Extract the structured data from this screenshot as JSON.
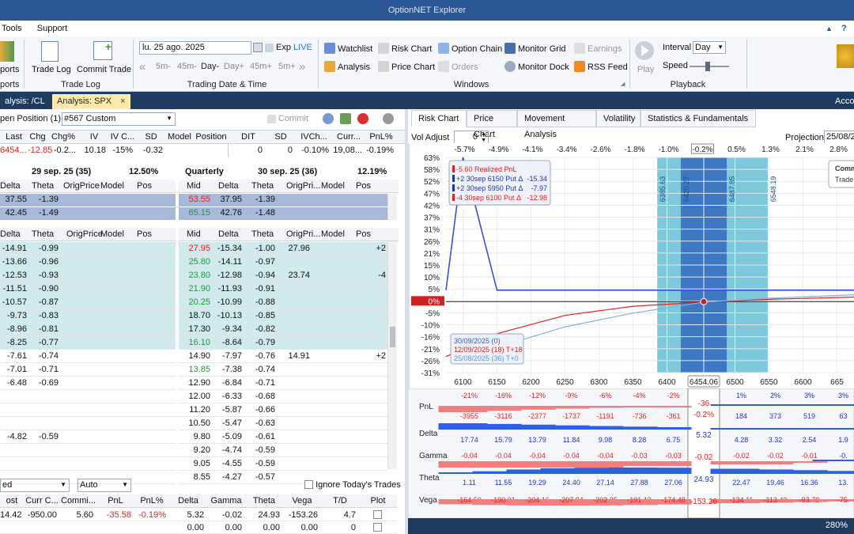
{
  "app": {
    "title": "OptionNET Explorer"
  },
  "menu": {
    "tools": "Tools",
    "support": "Support",
    "help": "?"
  },
  "ribbon": {
    "reports_btn": "ports",
    "reports_group": "ports",
    "trade_log_btn": "Trade Log",
    "commit_trade_btn": "Commit Trade",
    "trade_log_group": "Trade Log",
    "date_value": "lu. 25 ago. 2025",
    "exp_label": "Exp",
    "live_label": "LIVE",
    "step_buttons": [
      "5m-",
      "45m-",
      "Day-",
      "Day+",
      "45m+",
      "5m+"
    ],
    "date_group": "Trading Date & Time",
    "windows": [
      [
        "Watchlist",
        "Risk Chart",
        "Option Chain",
        "Monitor Grid",
        "Earnings"
      ],
      [
        "Analysis",
        "Price Chart",
        "Orders",
        "Monitor Dock",
        "RSS Feed"
      ]
    ],
    "windows_group": "Windows",
    "play_label": "Play",
    "interval_label": "Interval",
    "interval_value": "Day",
    "speed_label": "Speed",
    "playback_group": "Playback",
    "accent": "#2b5797"
  },
  "tabs": [
    {
      "label": "alysis: /CL"
    },
    {
      "label": "Analysis: SPX"
    }
  ],
  "tab_close": "×",
  "tabs_right": "Accou",
  "left": {
    "position_label": "pen Position (1)",
    "position_value": "#567 Custom",
    "commit": "Commit",
    "quote_headers": [
      "Last",
      "Chg",
      "Chg%",
      "IV",
      "IV C...",
      "SD",
      "Model",
      "Position",
      "DIT",
      "SD",
      "IVCh...",
      "Curr...",
      "PnL%"
    ],
    "quote_values": [
      "6454...",
      "-12.85",
      "-0.2...",
      "10.18",
      "-15%",
      "-0.32",
      "",
      "",
      "0",
      "0",
      "-0.10%",
      "19,08...",
      "-0.19%"
    ],
    "exp1": {
      "date": "29 sep. 25 (35)",
      "iv": "12.50%"
    },
    "exp2": {
      "name": "Quarterly",
      "date": "30 sep. 25 (36)",
      "iv": "12.19%"
    },
    "top_headers_left": [
      "Delta",
      "Theta",
      "OrigPrice",
      "Model",
      "Pos"
    ],
    "top_headers_right": [
      "Mid",
      "Delta",
      "Theta",
      "OrigPri...",
      "Model",
      "Pos"
    ],
    "top_rows": [
      {
        "l": [
          "37.55",
          "-1.39"
        ],
        "r": [
          "53.55",
          "37.95",
          "-1.39"
        ]
      },
      {
        "l": [
          "42.45",
          "-1.49"
        ],
        "r": [
          "65.15",
          "42.76",
          "-1.48"
        ]
      }
    ],
    "main_headers_left": [
      "Delta",
      "Theta",
      "OrigPrice",
      "Model",
      "Pos"
    ],
    "main_headers_right": [
      "Mid",
      "Delta",
      "Theta",
      "OrigPri...",
      "Model",
      "Pos"
    ],
    "main_rows": [
      {
        "l": [
          "-14.91",
          "-0.99"
        ],
        "r": [
          "27.95",
          "-15.34",
          "-1.00",
          "27.96",
          "",
          "+2"
        ],
        "hl": true,
        "col": "red"
      },
      {
        "l": [
          "-13.66",
          "-0.96"
        ],
        "r": [
          "25.80",
          "-14.11",
          "-0.97",
          "",
          "",
          ""
        ],
        "hl": true,
        "col": "grn"
      },
      {
        "l": [
          "-12.53",
          "-0.93"
        ],
        "r": [
          "23.80",
          "-12.98",
          "-0.94",
          "23.74",
          "",
          "-4"
        ],
        "hl": true,
        "col": "grn"
      },
      {
        "l": [
          "-11.51",
          "-0.90"
        ],
        "r": [
          "21.90",
          "-11.93",
          "-0.91",
          "",
          "",
          ""
        ],
        "hl": true,
        "col": "grn"
      },
      {
        "l": [
          "-10.57",
          "-0.87"
        ],
        "r": [
          "20.25",
          "-10.99",
          "-0.88",
          "",
          "",
          ""
        ],
        "hl": true,
        "col": "grn"
      },
      {
        "l": [
          "-9.73",
          "-0.83"
        ],
        "r": [
          "18.70",
          "-10.13",
          "-0.85",
          "",
          "",
          ""
        ],
        "hl": true,
        "col": ""
      },
      {
        "l": [
          "-8.96",
          "-0.81"
        ],
        "r": [
          "17.30",
          "-9.34",
          "-0.82",
          "",
          "",
          ""
        ],
        "hl": true,
        "col": ""
      },
      {
        "l": [
          "-8.25",
          "-0.77"
        ],
        "r": [
          "16.10",
          "-8.64",
          "-0.79",
          "",
          "",
          ""
        ],
        "hl": true,
        "col": "grn"
      },
      {
        "l": [
          "-7.61",
          "-0.74"
        ],
        "r": [
          "14.90",
          "-7.97",
          "-0.76",
          "14.91",
          "",
          "+2"
        ],
        "hl": false,
        "col": ""
      },
      {
        "l": [
          "-7.01",
          "-0.71"
        ],
        "r": [
          "13.85",
          "-7.38",
          "-0.74",
          "",
          "",
          ""
        ],
        "hl": false,
        "col": "grn"
      },
      {
        "l": [
          "-6.48",
          "-0.69"
        ],
        "r": [
          "12.90",
          "-6.84",
          "-0.71",
          "",
          "",
          ""
        ],
        "hl": false,
        "col": ""
      },
      {
        "l": [
          "",
          ""
        ],
        "r": [
          "12.00",
          "-6.33",
          "-0.68",
          "",
          "",
          ""
        ],
        "hl": false,
        "col": ""
      },
      {
        "l": [
          "",
          ""
        ],
        "r": [
          "11.20",
          "-5.87",
          "-0.66",
          "",
          "",
          ""
        ],
        "hl": false,
        "col": ""
      },
      {
        "l": [
          "",
          ""
        ],
        "r": [
          "10.50",
          "-5.47",
          "-0.63",
          "",
          "",
          ""
        ],
        "hl": false,
        "col": ""
      },
      {
        "l": [
          "-4.82",
          "-0.59"
        ],
        "r": [
          "9.80",
          "-5.09",
          "-0.61",
          "",
          "",
          ""
        ],
        "hl": false,
        "col": ""
      },
      {
        "l": [
          "",
          ""
        ],
        "r": [
          "9.20",
          "-4.74",
          "-0.59",
          "",
          "",
          ""
        ],
        "hl": false,
        "col": ""
      },
      {
        "l": [
          "",
          ""
        ],
        "r": [
          "9.05",
          "-4.55",
          "-0.59",
          "",
          "",
          ""
        ],
        "hl": false,
        "col": ""
      },
      {
        "l": [
          "",
          ""
        ],
        "r": [
          "8.55",
          "-4.27",
          "-0.57",
          "",
          "",
          ""
        ],
        "hl": false,
        "col": ""
      }
    ],
    "bottom_select1": "ed",
    "bottom_select2": "Auto",
    "ignore_label": "Ignore Today's Trades",
    "bottom_headers": [
      "ost",
      "Curr C...",
      "Commi...",
      "PnL",
      "PnL%",
      "Delta",
      "Gamma",
      "Theta",
      "Vega",
      "T/D",
      "Plot"
    ],
    "bottom_rows": [
      [
        "14.42",
        "-950.00",
        "5.60",
        "-35.58",
        "-0.19%",
        "5.32",
        "-0.02",
        "24.93",
        "-153.26",
        "4.7",
        ""
      ],
      [
        "",
        "",
        "",
        "",
        "",
        "0.00",
        "0.00",
        "0.00",
        "0.00",
        "0",
        ""
      ]
    ]
  },
  "right": {
    "tabs": [
      "Risk Chart",
      "Price Chart",
      "Movement Analysis",
      "Volatility",
      "Statistics & Fundamentals"
    ],
    "vol_adjust_label": "Vol Adjust",
    "vol_adjust_value": "0",
    "projection_label": "Projection",
    "projection_value": "25/08/2",
    "pct_axis": [
      "-5.7%",
      "-4.9%",
      "-4.1%",
      "-3.4%",
      "-2.6%",
      "-1.8%",
      "-1.0%",
      "-0.2%",
      "0.5%",
      "1.3%",
      "2.1%",
      "2.8%"
    ],
    "y_ticks": [
      "63%",
      "58%",
      "52%",
      "47%",
      "42%",
      "37%",
      "31%",
      "26%",
      "21%",
      "15%",
      "10%",
      "5%",
      "0%",
      "-5%",
      "-10%",
      "-16%",
      "-21%",
      "-26%",
      "-31%"
    ],
    "x_ticks": [
      "6100",
      "6150",
      "6200",
      "6250",
      "6300",
      "6350",
      "6400",
      "6454.06",
      "6500",
      "6550",
      "6600",
      "665"
    ],
    "band_labels": [
      "6385.63",
      "6420.27",
      "6487.85",
      "6548.19"
    ],
    "legend": [
      {
        "text": "-5.60 Realized PnL",
        "val": "",
        "color": "#e0221f"
      },
      {
        "text": "+2 30sep  6150 Put Δ",
        "val": "-15.34",
        "color": "#2233aa"
      },
      {
        "text": "+2 30sep  5950 Put Δ",
        "val": "-7.97",
        "color": "#2233aa"
      },
      {
        "text": "-4 30sep  6100 Put Δ",
        "val": "-12.98",
        "color": "#e0221f"
      }
    ],
    "curves_legend": [
      {
        "text": "30/09/2025 (0)",
        "color": "#3355cc"
      },
      {
        "text": "12/09/2025 (18) T+18",
        "color": "#e0221f"
      },
      {
        "text": "25/08/2025 (36) T+0",
        "color": "#5b9bd5"
      }
    ],
    "comm_box": [
      "Comm",
      "Trade"
    ],
    "greeks": {
      "pnl_label": "PnL",
      "delta_label": "Delta",
      "gamma_label": "Gamma",
      "theta_label": "Theta",
      "vega_label": "Vega",
      "pnl_pct": [
        "-21%",
        "-16%",
        "-12%",
        "-9%",
        "-6%",
        "-4%",
        "-2%",
        "",
        "1%",
        "2%",
        "3%",
        "3%"
      ],
      "pnl_vals": [
        "-3955",
        "-3116",
        "-2377",
        "-1737",
        "-1191",
        "-736",
        "-361",
        "",
        "184",
        "373",
        "519",
        "63"
      ],
      "pnl_center": "-36",
      "pnl_center_pct": "-0.2%",
      "delta_vals": [
        "17.74",
        "15.79",
        "13.79",
        "11.84",
        "9.98",
        "8.28",
        "6.75",
        "",
        "4.28",
        "3.32",
        "2.54",
        "1.9"
      ],
      "delta_center": "5.32",
      "gamma_vals": [
        "-0.04",
        "-0.04",
        "-0.04",
        "-0.04",
        "-0.04",
        "-0.03",
        "-0.03",
        "",
        "-0.02",
        "-0.02",
        "-0.01",
        "-0."
      ],
      "gamma_center": "-0.02",
      "theta_vals": [
        "1.11",
        "11.55",
        "19.29",
        "24.40",
        "27.14",
        "27.88",
        "27.06",
        "",
        "22.47",
        "19.46",
        "16.36",
        "13."
      ],
      "theta_center": "24.93",
      "vega_vals": [
        "-164.50",
        "-190.01",
        "-204.16",
        "-207.94",
        "-202.95",
        "-191.13",
        "-174.48",
        "",
        "-134.11",
        "-113.40",
        "-93.78",
        "-75."
      ],
      "vega_center": "-153.26"
    },
    "status_zoom": "280%"
  },
  "chart_data": {
    "type": "line",
    "xlabel": "",
    "ylabel": "",
    "xlim": [
      6075,
      6675
    ],
    "ylim": [
      -31,
      63
    ],
    "current_price": 6454.06,
    "series": [
      {
        "name": "30/09/2025 (0)",
        "x": [
          6075,
          6100,
          6150,
          6650,
          6675
        ],
        "y": [
          0,
          63,
          5,
          5,
          5
        ]
      },
      {
        "name": "12/09/2025 (18) T+18",
        "x": [
          6075,
          6150,
          6250,
          6350,
          6454,
          6550,
          6675
        ],
        "y": [
          -24,
          -14,
          -6,
          -2,
          -0.2,
          1,
          2
        ]
      },
      {
        "name": "25/08/2025 (36) T+0",
        "x": [
          6150,
          6250,
          6350,
          6454,
          6550,
          6675
        ],
        "y": [
          -20,
          -11,
          -5,
          -0.2,
          1.5,
          3
        ]
      }
    ]
  }
}
